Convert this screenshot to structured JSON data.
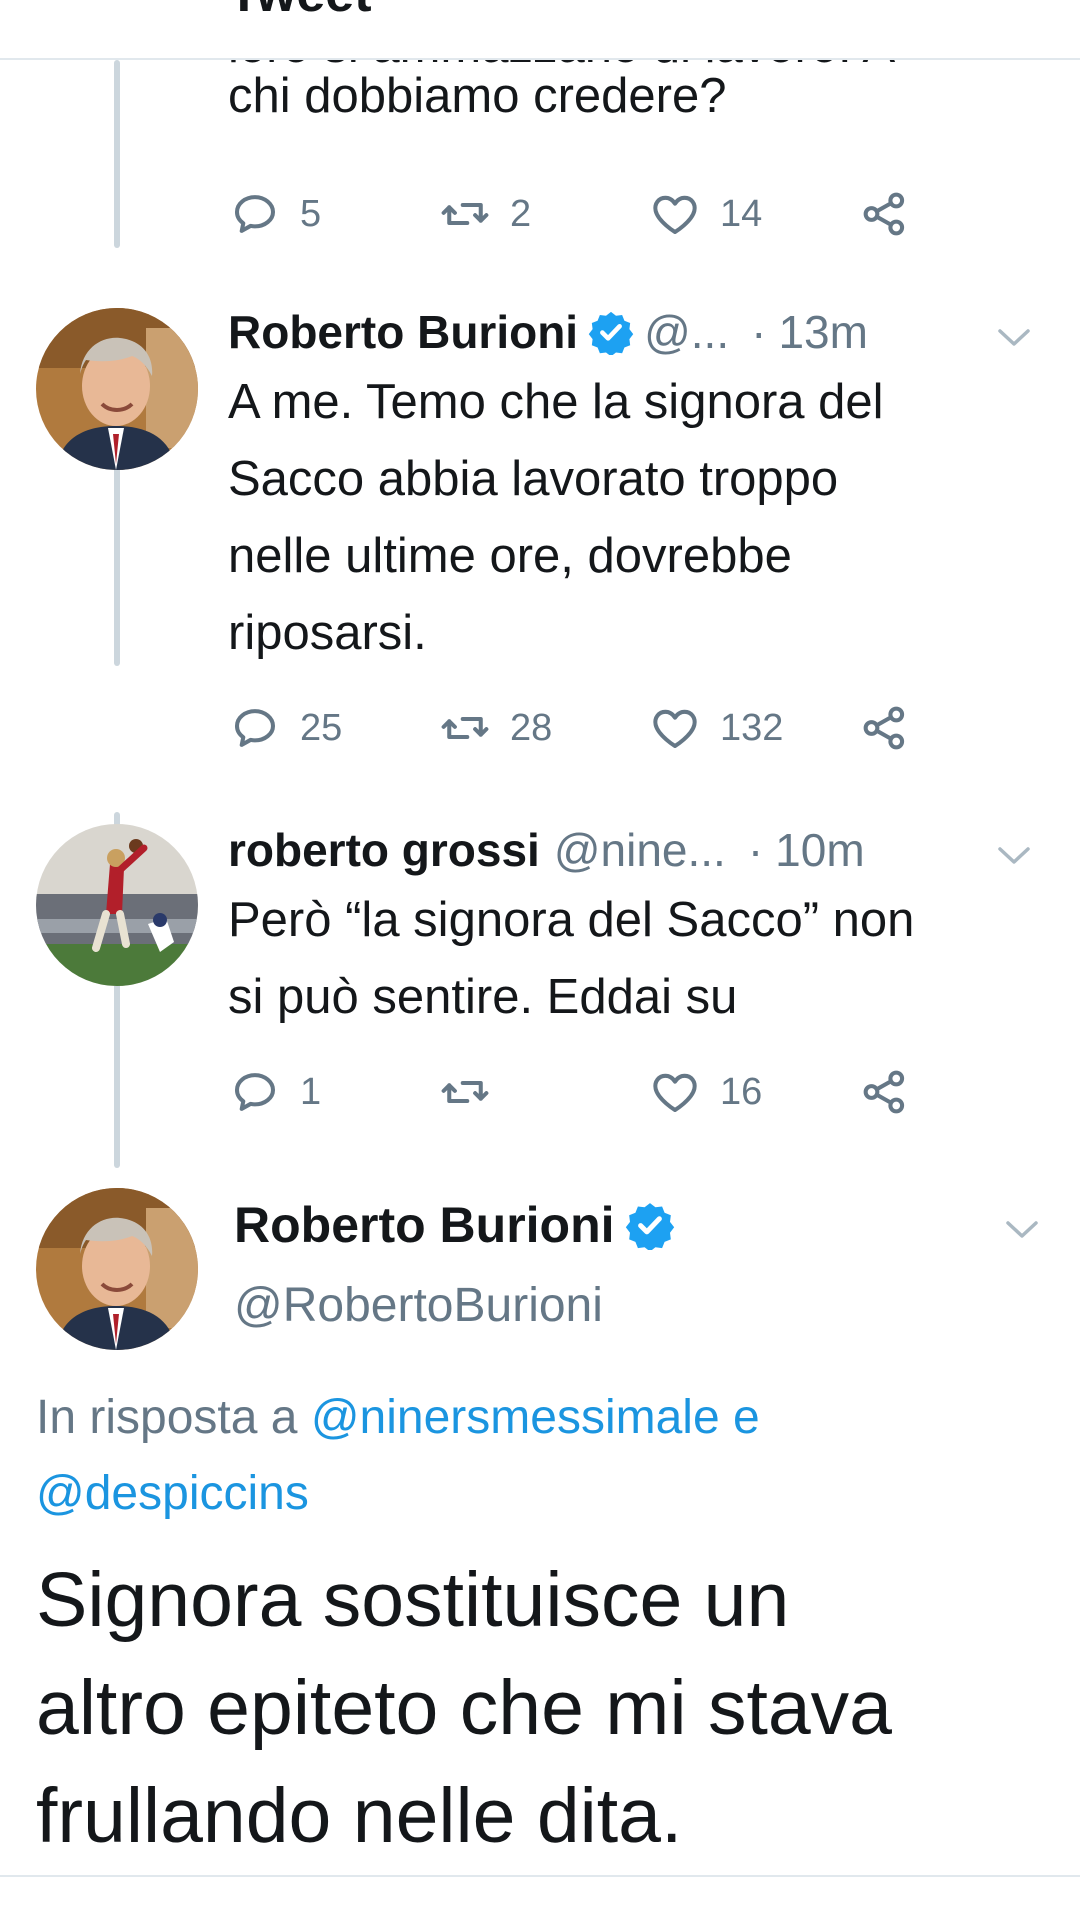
{
  "header": {
    "title": "Tweet"
  },
  "context_tweet": {
    "text_last_line": "chi dobbiamo credere?",
    "text_cut_line": "loro si ammazzano di lavoro. A",
    "replies": "5",
    "retweets": "2",
    "likes": "14"
  },
  "thread": [
    {
      "name": "Roberto Burioni",
      "handle": "@...",
      "separator": "·",
      "time": "13m",
      "verified": true,
      "text_lines": [
        "A me. Temo che la signora del",
        "Sacco abbia lavorato troppo",
        "nelle ultime ore, dovrebbe",
        "riposarsi."
      ],
      "replies": "25",
      "retweets": "28",
      "likes": "132"
    },
    {
      "name": "roberto grossi",
      "handle": "@nine...",
      "separator": "·",
      "time": "10m",
      "verified": false,
      "text_lines": [
        "Però “la signora del Sacco” non",
        "si può sentire. Eddai su"
      ],
      "replies": "1",
      "retweets": "",
      "likes": "16"
    }
  ],
  "main_tweet": {
    "name": "Roberto Burioni",
    "handle": "@RobertoBurioni",
    "reply_prefix": "In risposta a",
    "reply_user1": "@ninersmessimale",
    "reply_and": "e",
    "reply_user2": "@despiccins",
    "text_lines": [
      "Signora sostituisce un",
      "altro epiteto che mi stava",
      "frullando nelle dita."
    ]
  },
  "icons": {
    "reply": "reply-icon",
    "retweet": "retweet-icon",
    "like": "heart-icon",
    "share": "share-icon",
    "verified": "verified-badge-icon",
    "more": "chevron-down-icon"
  },
  "colors": {
    "text": "#14171a",
    "secondary": "#657786",
    "link": "#1b95e0",
    "verified": "#1da1f2",
    "thread_line": "#ccd6dd"
  }
}
